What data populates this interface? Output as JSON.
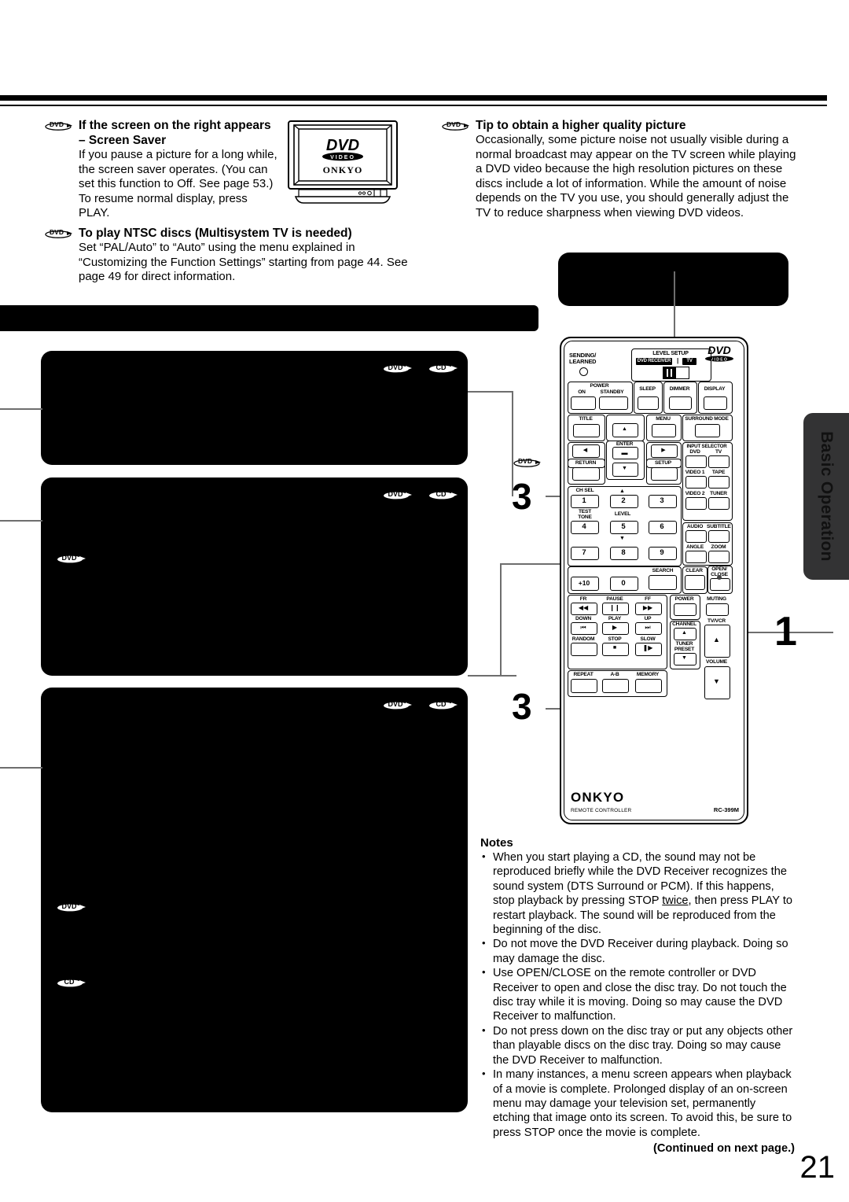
{
  "page": {
    "number": "21",
    "side_tab_label": "Basic Operation",
    "continued_note": "(Continued on next page.)"
  },
  "tips": {
    "screen_saver": {
      "badge": "DVD",
      "heading_line1": "If the screen on the right appears",
      "heading_line2": "– Screen Saver",
      "body": "If you pause a picture for a long while, the screen saver operates. (You can set this function to Off. See page 53.) To resume normal display, press PLAY."
    },
    "ntsc": {
      "badge": "DVD",
      "heading": "To play NTSC discs (Multisystem TV is needed)",
      "body": "Set “PAL/Auto” to “Auto” using the menu explained in “Customizing the Function Settings” starting from page 44. See page 49 for direct information."
    },
    "quality": {
      "badge": "DVD",
      "heading": "Tip to obtain a higher quality picture",
      "body": "Occasionally, some picture noise not usually visible during a normal broadcast may appear on the TV screen while playing a DVD video because the high resolution pictures on these discs include a lot of information. While the amount of noise depends on the TV you use, you should generally adjust the TV to reduce sharpness when viewing DVD videos."
    }
  },
  "tv_illustration": {
    "logo_main": "DVD",
    "logo_sub": "VIDEO",
    "brand": "ONKYO"
  },
  "callouts": {
    "step_1": "1",
    "step_3a": "3",
    "step_3b": "3",
    "step_3a_badge": "DVD"
  },
  "disc_badges": {
    "block1": [
      "DVD",
      "CD"
    ],
    "block2": [
      "DVD",
      "CD"
    ],
    "block2_inner": [
      "DVD"
    ],
    "block3": [
      "DVD",
      "CD"
    ],
    "block3_inner": [
      "DVD",
      "CD"
    ]
  },
  "remote": {
    "brand": "ONKYO",
    "brand_sub": "REMOTE CONTROLLER",
    "model": "RC-399M",
    "logo_main": "DVD",
    "logo_sub": "VIDEO",
    "indicator_label_1": "SENDING/",
    "indicator_label_2": "LEARNED",
    "level_setup": {
      "title": "LEVEL SETUP",
      "left": "DVD RECEIVER",
      "divider": "|",
      "right": "TV"
    },
    "power": {
      "group": "POWER",
      "on": "ON",
      "standby": "STANDBY"
    },
    "buttons": {
      "sleep": "SLEEP",
      "dimmer": "DIMMER",
      "display": "DISPLAY",
      "title": "TITLE",
      "menu": "MENU",
      "surround_mode": "SURROUND MODE",
      "enter": "ENTER",
      "return": "RETURN",
      "setup": "SETUP",
      "input_selector": "INPUT SELECTOR",
      "input_dvd": "DVD",
      "input_tv": "TV",
      "video1": "VIDEO 1",
      "tape": "TAPE",
      "video2": "VIDEO 2",
      "tuner": "TUNER",
      "ch_sel": "CH SEL",
      "test_tone_1": "TEST",
      "test_tone_2": "TONE",
      "level": "LEVEL",
      "audio": "AUDIO",
      "subtitle": "SUBTITLE",
      "angle": "ANGLE",
      "zoom": "ZOOM",
      "search": "SEARCH",
      "clear": "CLEAR",
      "open_close_1": "OPEN/",
      "open_close_2": "CLOSE",
      "fr": "FR",
      "pause": "PAUSE",
      "ff": "FF",
      "power2": "POWER",
      "muting": "MUTING",
      "down": "DOWN",
      "play": "PLAY",
      "up": "UP",
      "channel": "CHANNEL",
      "tv_vcr": "TV/VCR",
      "random": "RANDOM",
      "stop": "STOP",
      "slow": "SLOW",
      "tuner_preset_1": "TUNER",
      "tuner_preset_2": "PRESET",
      "volume": "VOLUME",
      "repeat": "REPEAT",
      "ab": "A-B",
      "memory": "MEMORY"
    },
    "numeric_keys": [
      "1",
      "2",
      "3",
      "4",
      "5",
      "6",
      "7",
      "8",
      "9",
      "+10",
      "0"
    ]
  },
  "notes": {
    "title": "Notes",
    "items": [
      "When you start playing a CD, the sound may not be reproduced briefly while the DVD Receiver recognizes the sound system (DTS Surround or PCM). If this happens, stop playback by pressing STOP twice, then press PLAY to restart playback. The sound will be reproduced from the beginning of the disc.",
      "Do not move the DVD Receiver during playback. Doing so may damage the disc.",
      "Use OPEN/CLOSE on the remote controller or DVD Receiver to open and close the disc tray. Do not touch the disc tray while it is moving. Doing so may cause the DVD Receiver to malfunction.",
      "Do not press down on the disc tray or put any objects other than playable discs on the disc tray. Doing so may cause the DVD Receiver to malfunction.",
      "In many instances, a menu screen appears when playback of a movie is complete. Prolonged display of an on-screen menu may damage your television set, permanently etching that image onto its screen. To avoid this, be sure to press STOP once the movie is complete."
    ]
  }
}
